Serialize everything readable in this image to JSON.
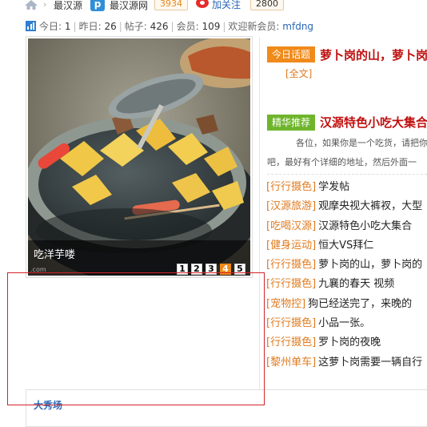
{
  "breadcrumb": {
    "site": "最汉源",
    "qq_name": "最汉源网",
    "qq_count": "3934",
    "follow": "加关注",
    "weibo_count": "2800"
  },
  "stats": {
    "today_label": "今日:",
    "today": "1",
    "yesterday_label": "昨日:",
    "yesterday": "26",
    "posts_label": "帖子:",
    "posts": "426",
    "members_label": "会员:",
    "members": "109",
    "welcome_label": "欢迎新会员:",
    "new_member": "mfdng"
  },
  "slideshow": {
    "caption": "吃洋芋喽",
    "watermark": ".com",
    "pages": [
      "1",
      "2",
      "3",
      "4",
      "5"
    ],
    "active_page": "4"
  },
  "today_topic": {
    "tag": "今日话题",
    "title": "萝卜岗的山，萝卜岗",
    "fulltext": "[全文]"
  },
  "recommend": {
    "tag": "精华推荐",
    "title": "汉源特色小吃大集合",
    "desc_line1": "各位，如果你是一个吃货，请把你",
    "desc_line2": "吧，最好有个详细的地址，然后外面一"
  },
  "threads": [
    {
      "cat": "[行行摄色]",
      "title": "学发帖"
    },
    {
      "cat": "[汉源旅游]",
      "title": "观摩央视大裤衩，大型"
    },
    {
      "cat": "[吃喝汉源]",
      "title": "汉源特色小吃大集合"
    },
    {
      "cat": "[健身运动]",
      "title": "恒大VS拜仁"
    },
    {
      "cat": "[行行摄色]",
      "title": "萝卜岗的山，萝卜岗的"
    },
    {
      "cat": "[行行摄色]",
      "title": "九襄的春天 视频"
    },
    {
      "cat": "[宠物控]",
      "title": "狗已经送完了，来晚的"
    },
    {
      "cat": "[行行摄色]",
      "title": "小品一张。"
    },
    {
      "cat": "[行行摄色]",
      "title": "罗卜岗的夜晚"
    },
    {
      "cat": "[黎州单车]",
      "title": "这萝卜岗需要一辆自行"
    }
  ],
  "panel": {
    "title": "大秀场"
  },
  "colors": {
    "accent_orange": "#f08a1a",
    "accent_green": "#6fb52c",
    "title_red": "#c01010",
    "link_blue": "#2a66b5",
    "frame_red": "#d2232a"
  }
}
